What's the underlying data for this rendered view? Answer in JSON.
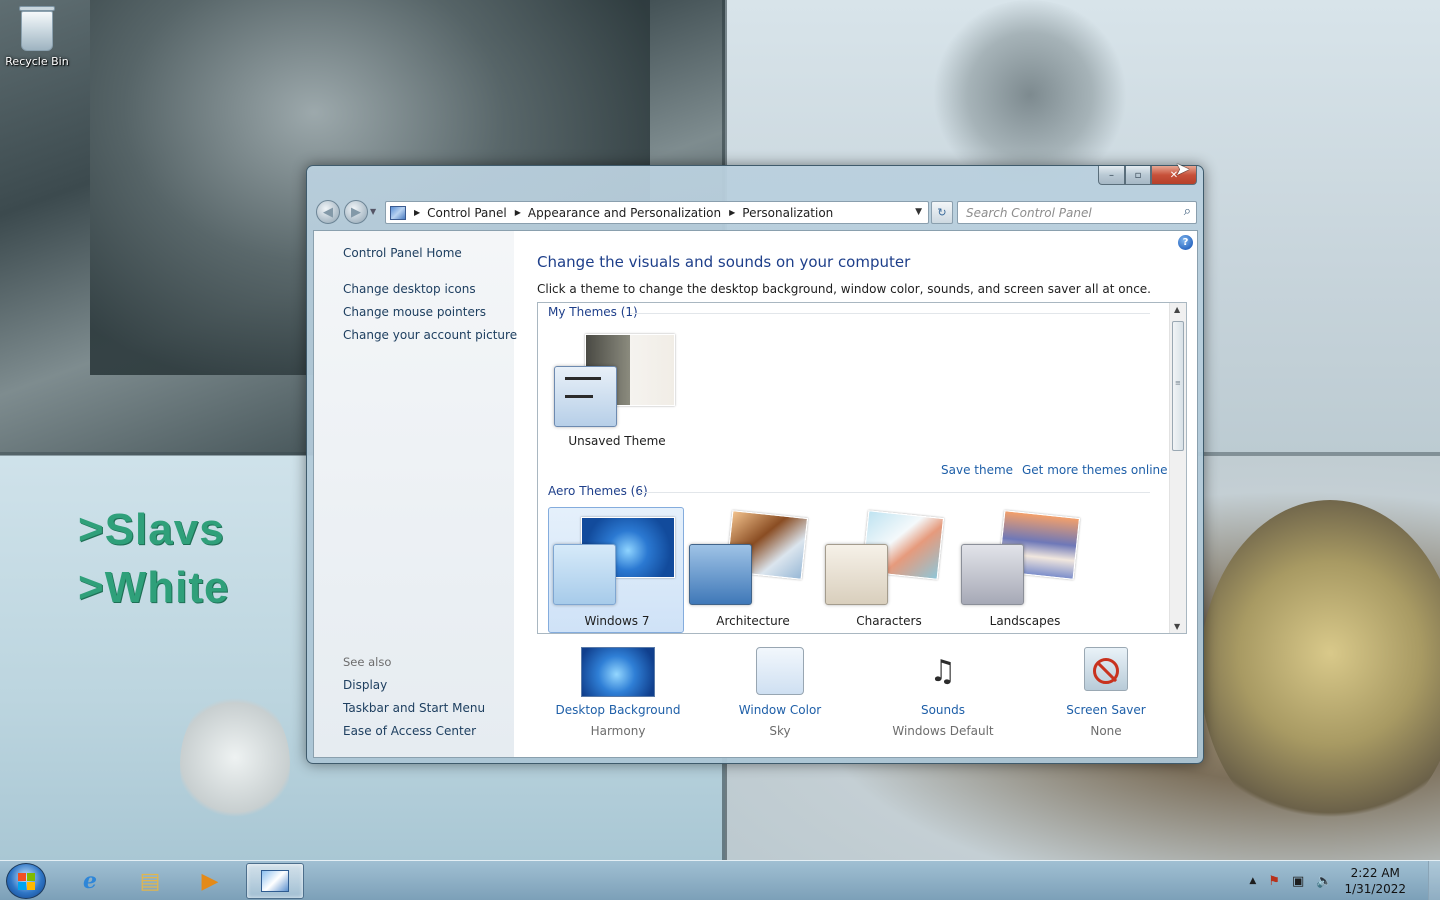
{
  "desktop": {
    "recycle_bin_label": "Recycle Bin",
    "wallpaper_text_1": ">Slavs",
    "wallpaper_text_2": ">White"
  },
  "window": {
    "titlebar": {
      "minimize": "–",
      "maximize": "▫",
      "close": "✕"
    },
    "nav": {
      "back_icon": "arrow-left",
      "forward_icon": "arrow-right",
      "breadcrumbs": [
        "Control Panel",
        "Appearance and Personalization",
        "Personalization"
      ],
      "search_placeholder": "Search Control Panel",
      "refresh_glyph": "↻"
    },
    "left_pane": {
      "home": "Control Panel Home",
      "tasks": [
        "Change desktop icons",
        "Change mouse pointers",
        "Change your account picture"
      ],
      "see_also_label": "See also",
      "see_also": [
        "Display",
        "Taskbar and Start Menu",
        "Ease of Access Center"
      ]
    },
    "main": {
      "heading": "Change the visuals and sounds on your computer",
      "description": "Click a theme to change the desktop background, window color, sounds, and screen saver all at once.",
      "my_themes_header": "My Themes (1)",
      "my_themes": [
        {
          "label": "Unsaved Theme"
        }
      ],
      "save_theme": "Save theme",
      "get_more_themes": "Get more themes online",
      "aero_themes_header": "Aero Themes (6)",
      "aero_themes": [
        {
          "label": "Windows 7",
          "selected": true
        },
        {
          "label": "Architecture",
          "selected": false
        },
        {
          "label": "Characters",
          "selected": false
        },
        {
          "label": "Landscapes",
          "selected": false
        }
      ],
      "settings": [
        {
          "title": "Desktop Background",
          "value": "Harmony",
          "icon": "desktop-background-icon"
        },
        {
          "title": "Window Color",
          "value": "Sky",
          "icon": "window-color-icon"
        },
        {
          "title": "Sounds",
          "value": "Windows Default",
          "icon": "sounds-icon"
        },
        {
          "title": "Screen Saver",
          "value": "None",
          "icon": "screen-saver-icon"
        }
      ]
    }
  },
  "taskbar": {
    "pinned": [
      "start",
      "internet-explorer",
      "windows-explorer",
      "windows-media-player",
      "control-panel"
    ],
    "clock_time": "2:22 AM",
    "clock_date": "1/31/2022"
  },
  "colors": {
    "link_blue": "#1e5fa8",
    "heading_blue": "#1e3f8a",
    "close_red": "#c7513a",
    "selection_blue": "#cfe2f7"
  }
}
